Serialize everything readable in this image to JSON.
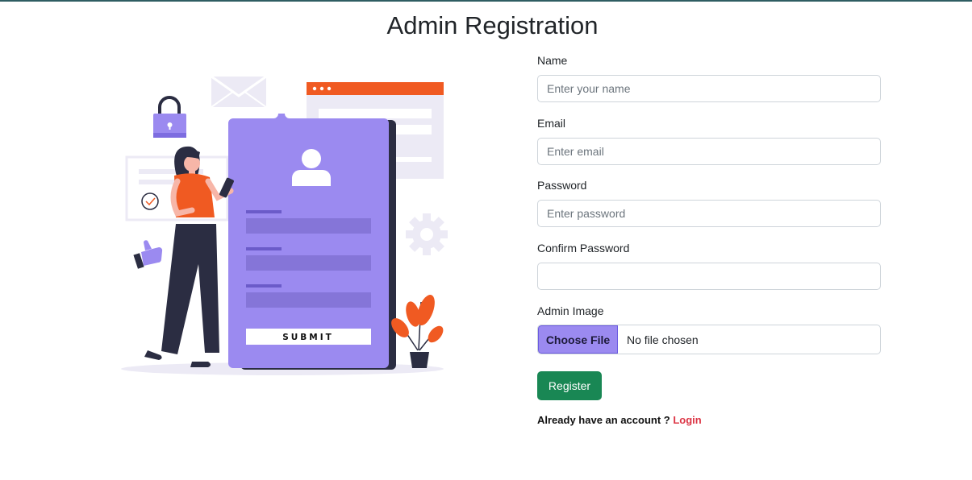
{
  "page": {
    "title": "Admin Registration"
  },
  "illustration": {
    "submit_label": "SUBMIT",
    "colors": {
      "primary": "#9b8af0",
      "accent": "#f05a22",
      "dark": "#2b2d42"
    }
  },
  "form": {
    "name": {
      "label": "Name",
      "placeholder": "Enter your name",
      "value": ""
    },
    "email": {
      "label": "Email",
      "placeholder": "Enter email",
      "value": ""
    },
    "password": {
      "label": "Password",
      "placeholder": "Enter password",
      "value": ""
    },
    "confirm_password": {
      "label": "Confirm Password",
      "placeholder": "",
      "value": ""
    },
    "admin_image": {
      "label": "Admin Image",
      "button_label": "Choose File",
      "status": "No file chosen"
    },
    "register_label": "Register",
    "login_prompt": "Already have an account ?",
    "login_link": "Login"
  },
  "colors": {
    "register_button": "#198754",
    "login_link": "#dc3545",
    "file_button": "#9b8af0"
  }
}
